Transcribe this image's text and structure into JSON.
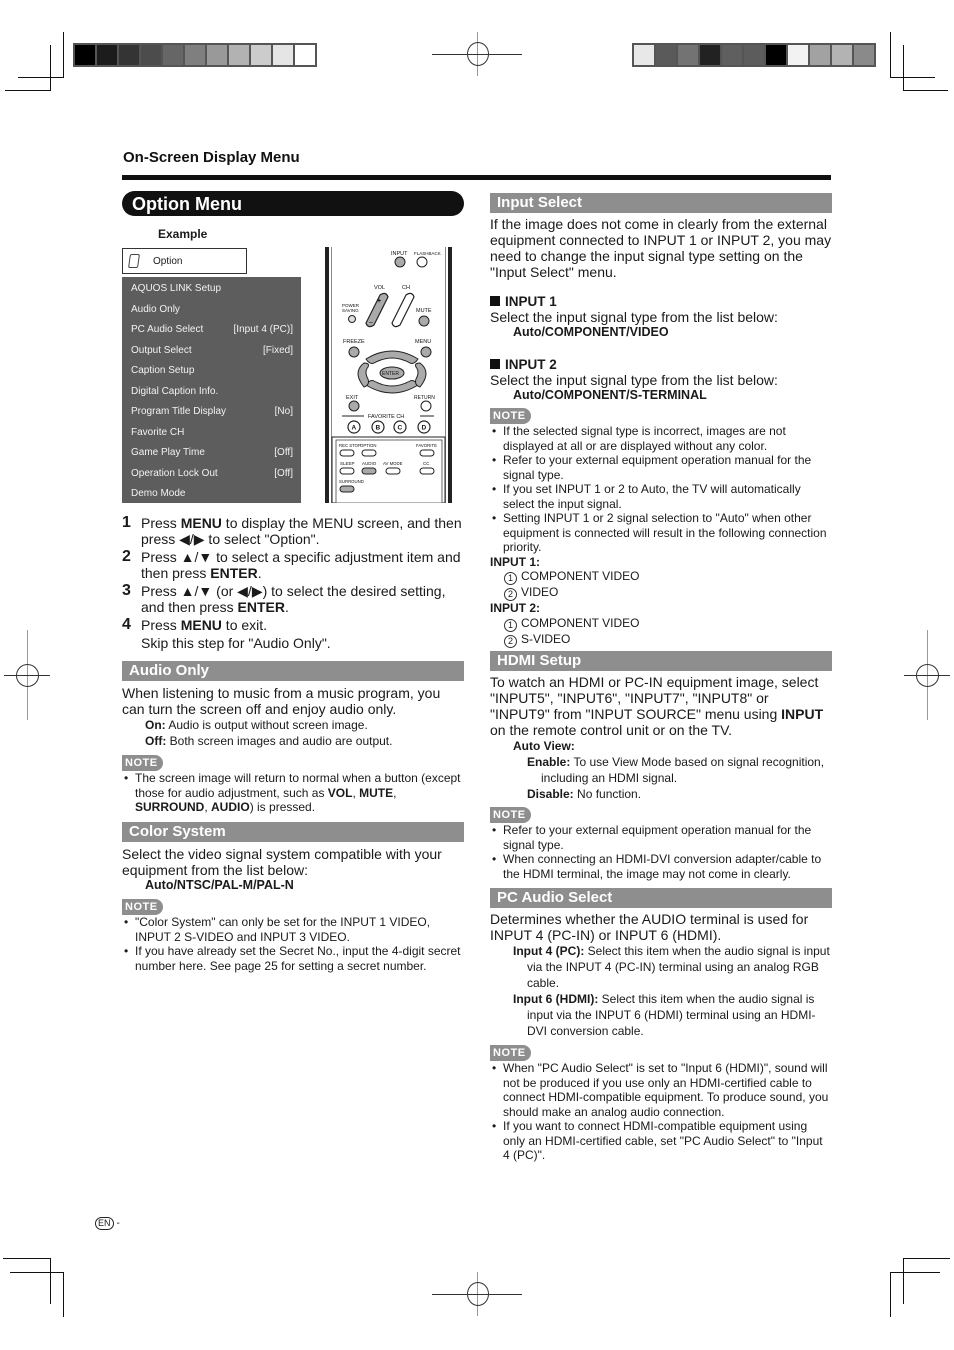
{
  "print_marks": {
    "left_swatches": [
      "#000000",
      "#1c1c1c",
      "#343434",
      "#4c4c4c",
      "#666666",
      "#7f7f7f",
      "#999999",
      "#b2b2b2",
      "#cccccc",
      "#e5e5e5",
      "#ffffff"
    ],
    "right_swatches": [
      "#e8e8e8",
      "#5a5a5a",
      "#737373",
      "#222222",
      "#5f5f5f",
      "#5c5c5c",
      "#000000",
      "#f2f2f2",
      "#a2a2a2",
      "#b3b3b3",
      "#8a8a8a"
    ]
  },
  "header": {
    "section": "On-Screen Display Menu",
    "title": "Option Menu"
  },
  "example": {
    "label": "Example",
    "tab_label": "Option",
    "menu_items": [
      {
        "label": "AQUOS LINK Setup",
        "value": ""
      },
      {
        "label": "Audio Only",
        "value": ""
      },
      {
        "label": "PC Audio Select",
        "value": "[Input 4 (PC)]"
      },
      {
        "label": "Output Select",
        "value": "[Fixed]"
      },
      {
        "label": "Caption Setup",
        "value": ""
      },
      {
        "label": "Digital Caption Info.",
        "value": ""
      },
      {
        "label": "Program Title Display",
        "value": "[No]"
      },
      {
        "label": "Favorite CH",
        "value": ""
      },
      {
        "label": "Game Play Time",
        "value": "[Off]"
      },
      {
        "label": "Operation Lock Out",
        "value": "[Off]"
      },
      {
        "label": "Demo Mode",
        "value": ""
      }
    ]
  },
  "remote": {
    "input": "INPUT",
    "flashback": "FLASHBACK",
    "vol": "VOL",
    "ch": "CH",
    "power_saving": "POWER SAVING",
    "mute": "MUTE",
    "freeze": "FREEZE",
    "menu": "MENU",
    "enter": "ENTER",
    "exit": "EXIT",
    "return": "RETURN",
    "favorite_ch": "FAVORITE CH",
    "fav_a": "A",
    "fav_b": "B",
    "fav_c": "C",
    "fav_d": "D",
    "rec_stop": "REC STOP",
    "option": "OPTION",
    "favorite": "FAVORITE",
    "sleep": "SLEEP",
    "audio": "AUDIO",
    "av_mode": "AV MODE",
    "cc": "CC",
    "surround": "SURROUND"
  },
  "steps": [
    {
      "num": "1",
      "pre": "Press ",
      "bold": "MENU",
      "post": " to display the MENU screen, and then press ◀/▶ to select \"Option\"."
    },
    {
      "num": "2",
      "pre": "Press ▲/▼ to select a specific adjustment item and then press ",
      "bold": "ENTER",
      "post": "."
    },
    {
      "num": "3",
      "pre": "Press ▲/▼ (or ◀/▶) to select the desired setting, and then press ",
      "bold": "ENTER",
      "post": "."
    },
    {
      "num": "4",
      "pre": "Press ",
      "bold": "MENU",
      "post": " to exit."
    }
  ],
  "step4_sub": "Skip this step for \"Audio Only\".",
  "note_label": "NOTE",
  "audio_only": {
    "title": "Audio Only",
    "intro": "When listening to music from a music program, you can turn the screen off and enjoy audio only.",
    "on_term": "On:",
    "on_desc": " Audio is output without screen image.",
    "off_term": "Off:",
    "off_desc": " Both screen images and audio are output.",
    "note_pre": "The screen image will return to normal when a button (except those for audio adjustment, such as ",
    "note_b1": "VOL",
    "note_sep1": ", ",
    "note_b2": "MUTE",
    "note_sep2": ", ",
    "note_b3": "SURROUND",
    "note_sep3": ", ",
    "note_b4": "AUDIO",
    "note_post": ") is pressed."
  },
  "color_system": {
    "title": "Color System",
    "intro": "Select the video signal system compatible with your equipment from the list below:",
    "options": "Auto/NTSC/PAL-M/PAL-N",
    "notes": [
      "\"Color System\" can only be set for the INPUT 1 VIDEO, INPUT 2 S-VIDEO and INPUT 3 VIDEO.",
      "If you have already set the Secret No., input the 4-digit secret number here. See page 25 for setting a secret number."
    ]
  },
  "input_select": {
    "title": "Input Select",
    "intro": "If the image does not come in clearly from the external equipment connected to INPUT 1 or INPUT 2, you may need to change the input signal type setting on the \"Input Select\" menu.",
    "input1_head": "INPUT 1",
    "input1_text": "Select the input signal type from the list below:",
    "input1_opts": "Auto/COMPONENT/VIDEO",
    "input2_head": "INPUT 2",
    "input2_text": "Select the input signal type from the list below:",
    "input2_opts": "Auto/COMPONENT/S-TERMINAL",
    "notes": [
      "If the selected signal type is incorrect, images are not displayed at all or are displayed without any color.",
      "Refer to your external equipment operation manual for the signal type.",
      "If you set INPUT 1 or 2 to Auto, the TV will automatically select the input signal.",
      "Setting INPUT 1 or 2 signal selection to \"Auto\" when other equipment is connected will result in the following connection priority."
    ],
    "priority": [
      {
        "head": "INPUT 1:",
        "items": [
          {
            "n": "1",
            "t": "COMPONENT VIDEO"
          },
          {
            "n": "2",
            "t": "VIDEO"
          }
        ]
      },
      {
        "head": "INPUT 2:",
        "items": [
          {
            "n": "1",
            "t": "COMPONENT VIDEO"
          },
          {
            "n": "2",
            "t": "S-VIDEO"
          }
        ]
      }
    ]
  },
  "hdmi_setup": {
    "title": "HDMI Setup",
    "intro_pre": "To watch an HDMI or PC-IN equipment image, select \"INPUT5\", \"INPUT6\", \"INPUT7\", \"INPUT8\" or \"INPUT9\" from \"INPUT SOURCE\" menu using ",
    "intro_bold": "INPUT",
    "intro_post": " on the remote control unit or on the TV.",
    "auto_view": "Auto View:",
    "enable_term": "Enable:",
    "enable_desc": " To use View Mode based on signal recognition, including an HDMI signal.",
    "disable_term": "Disable:",
    "disable_desc": " No function.",
    "notes": [
      "Refer to your external equipment operation manual for the signal type.",
      "When connecting an HDMI-DVI conversion adapter/cable to the HDMI terminal, the image may not come in clearly."
    ]
  },
  "pc_audio_select": {
    "title": "PC Audio Select",
    "intro": "Determines whether the AUDIO terminal is used for INPUT 4 (PC-IN) or INPUT 6 (HDMI).",
    "pc_term": "Input 4 (PC):",
    "pc_desc": " Select this item when the audio signal is input via the INPUT 4 (PC-IN) terminal using an analog RGB cable.",
    "hdmi_term": "Input 6 (HDMI):",
    "hdmi_desc": " Select this item when the audio signal is input via the INPUT 6 (HDMI) terminal using an HDMI-DVI conversion cable.",
    "notes": [
      "When \"PC Audio Select\" is set to \"Input 6 (HDMI)\", sound will not be produced if you use only an HDMI-certified cable to connect HDMI-compatible equipment. To produce sound, you should make an analog audio connection.",
      "If you want to connect HDMI-compatible equipment using only an HDMI-certified cable, set \"PC Audio Select\" to \"Input 4 (PC)\"."
    ]
  },
  "footer": {
    "lang": "EN",
    "dash": "-"
  }
}
